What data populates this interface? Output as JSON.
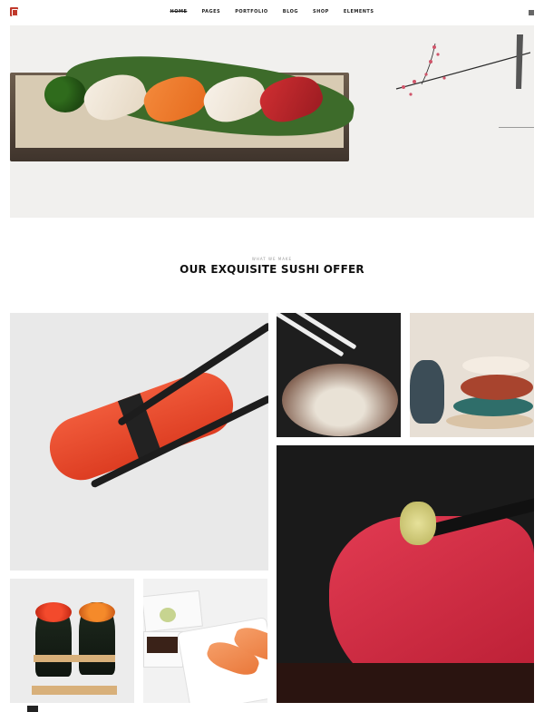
{
  "nav": {
    "items": [
      {
        "label": "HOME"
      },
      {
        "label": "PAGES"
      },
      {
        "label": "PORTFOLIO"
      },
      {
        "label": "BLOG"
      },
      {
        "label": "SHOP"
      },
      {
        "label": "ELEMENTS"
      }
    ],
    "active_index": 0
  },
  "icons": {
    "logo": "logo-icon",
    "menu": "grid-menu-icon"
  },
  "colors": {
    "logo_red": "#c0392b",
    "text": "#111111",
    "kicker": "#999999"
  },
  "section": {
    "kicker": "WHAT WE MAKE",
    "title": "OUR EXQUISITE SUSHI OFFER"
  },
  "gallery": [
    {
      "name": "crab-stick-roll"
    },
    {
      "name": "noodle-bowl"
    },
    {
      "name": "ceramic-bowls"
    },
    {
      "name": "tuna-sashimi"
    },
    {
      "name": "temaki-cones"
    },
    {
      "name": "salmon-nigiri-plate"
    }
  ]
}
